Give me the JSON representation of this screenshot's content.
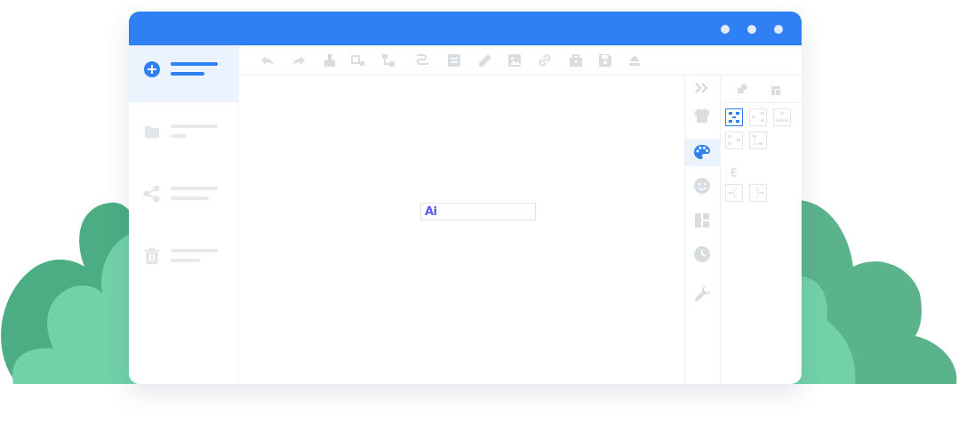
{
  "window": {
    "title_dots": [
      "window-dot-1",
      "window-dot-2",
      "window-dot-3"
    ]
  },
  "colors": {
    "accent": "#2f80f5",
    "bush_dark": "#4cad84",
    "bush_light": "#72d1a8",
    "ai_logo": "#5b58f0"
  },
  "sidebar": {
    "items": [
      {
        "icon": "plus-circle-icon",
        "active": true
      },
      {
        "icon": "folder-icon",
        "active": false
      },
      {
        "icon": "share-icon",
        "active": false
      },
      {
        "icon": "trash-icon",
        "active": false
      }
    ]
  },
  "toolbar": {
    "icons": [
      "undo-icon",
      "redo-icon",
      "format-painter-icon",
      "insert-node-icon",
      "insert-child-icon",
      "insert-summary-icon",
      "note-icon",
      "pen-icon",
      "image-icon",
      "link-icon",
      "package-icon",
      "save-icon",
      "export-icon"
    ]
  },
  "canvas": {
    "ai_logo_text": "Ai"
  },
  "rail": {
    "icons": [
      "collapse-icon",
      "shirt-icon",
      "palette-icon",
      "smiley-icon",
      "layout-icon",
      "clock-icon",
      "wrench-icon"
    ]
  },
  "panel": {
    "tabs": [
      "shapes-icon",
      "layout-tab-icon"
    ],
    "section_icon": "structure-icon"
  }
}
